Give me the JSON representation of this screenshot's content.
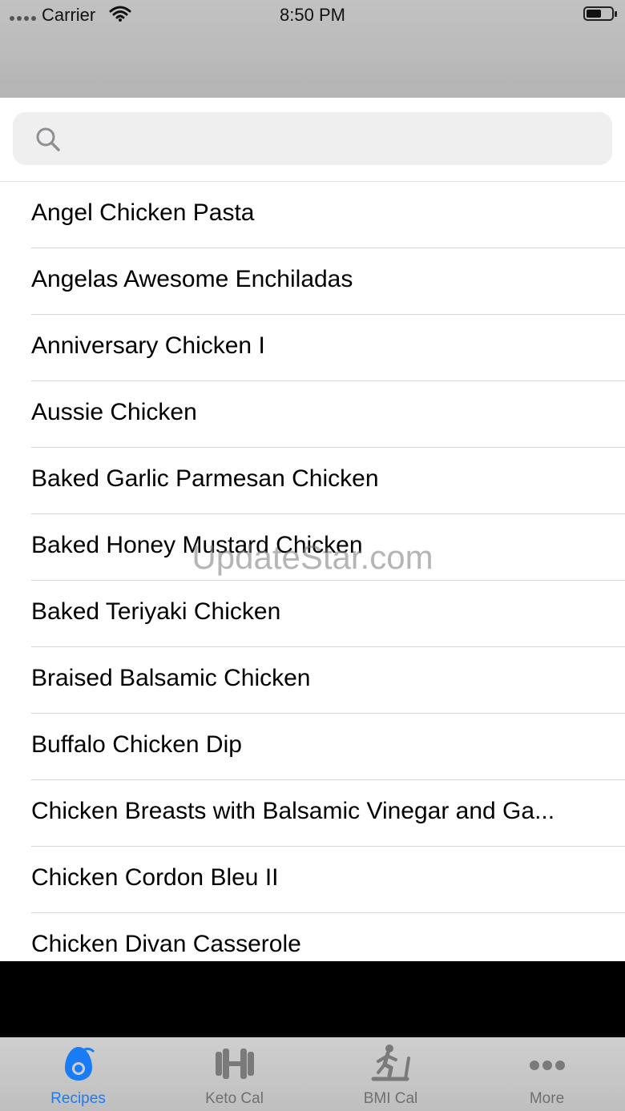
{
  "status_bar": {
    "carrier": "Carrier",
    "time": "8:50 PM"
  },
  "search": {
    "placeholder": "",
    "value": ""
  },
  "recipes": [
    "Angel Chicken Pasta",
    "Angelas Awesome Enchiladas",
    "Anniversary Chicken I",
    "Aussie Chicken",
    "Baked Garlic Parmesan Chicken",
    "Baked Honey Mustard Chicken",
    "Baked Teriyaki Chicken",
    "Braised Balsamic Chicken",
    "Buffalo Chicken Dip",
    "Chicken Breasts with Balsamic Vinegar and Ga...",
    "Chicken Cordon Bleu II",
    "Chicken Divan Casserole"
  ],
  "watermark": "UpdateStar.com",
  "tabs": [
    {
      "label": "Recipes",
      "icon": "avocado-icon",
      "active": true
    },
    {
      "label": "Keto Cal",
      "icon": "dumbbell-icon",
      "active": false
    },
    {
      "label": "BMI Cal",
      "icon": "treadmill-icon",
      "active": false
    },
    {
      "label": "More",
      "icon": "more-dots-icon",
      "active": false
    }
  ],
  "colors": {
    "accent": "#1a7cf5",
    "tab_inactive": "#6f6f6f"
  }
}
